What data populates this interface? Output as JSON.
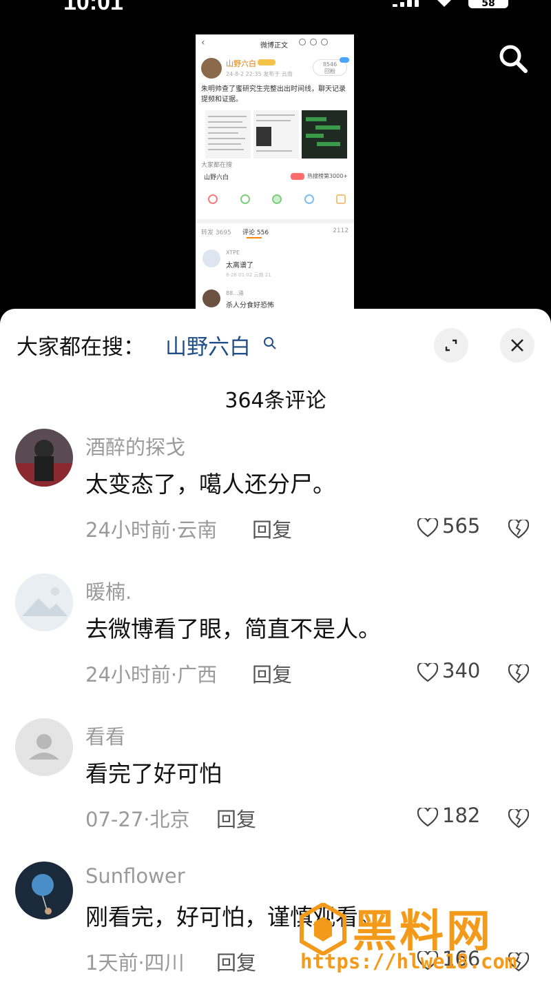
{
  "status_bar": {
    "time": "10:01",
    "battery": "58"
  },
  "embedded_post": {
    "title": "微博正文",
    "author": "山野六白",
    "meta": "24-8-2 22:35  发布于 云南",
    "follow_count": "8546",
    "follow_label": "回粉",
    "text": "朱明帅查了蜜研究生完整出出时间线，聊天记录提频和证据。",
    "searching_label": "大家都在搜",
    "search_keyword": "山野六白",
    "search_right": "热搜榜第3000+",
    "tab_repost": "转发 3695",
    "tab_comment": "评论 556",
    "tab_like": "2112",
    "comment1_user": "XTPE",
    "comment1_text": "太离谱了",
    "comment1_meta": "8-28 01:02  云南        21",
    "comment2_user": "88...涌",
    "comment2_text": "杀人分食好恐怖"
  },
  "panel": {
    "hot_label": "大家都在搜：",
    "hot_keyword": "山野六白",
    "comment_count": "364条评论",
    "reply_label": "回复"
  },
  "comments": [
    {
      "user": "酒醉的探戈",
      "text": "太变态了，噶人还分尸。",
      "meta": "24小时前·云南",
      "likes": "565"
    },
    {
      "user": "暖楠.",
      "text": "去微博看了眼，简直不是人。",
      "meta": "24小时前·广西",
      "likes": "340"
    },
    {
      "user": "看看",
      "text": "看完了好可怕",
      "meta": "07-27·北京",
      "likes": "182"
    },
    {
      "user": "Sunflower",
      "text": "刚看完，好可怕，谨慎观看。",
      "meta": "1天前·四川",
      "likes": "166"
    }
  ],
  "watermark": {
    "brand": "黑料网",
    "url": "https://hlwe18.com"
  }
}
